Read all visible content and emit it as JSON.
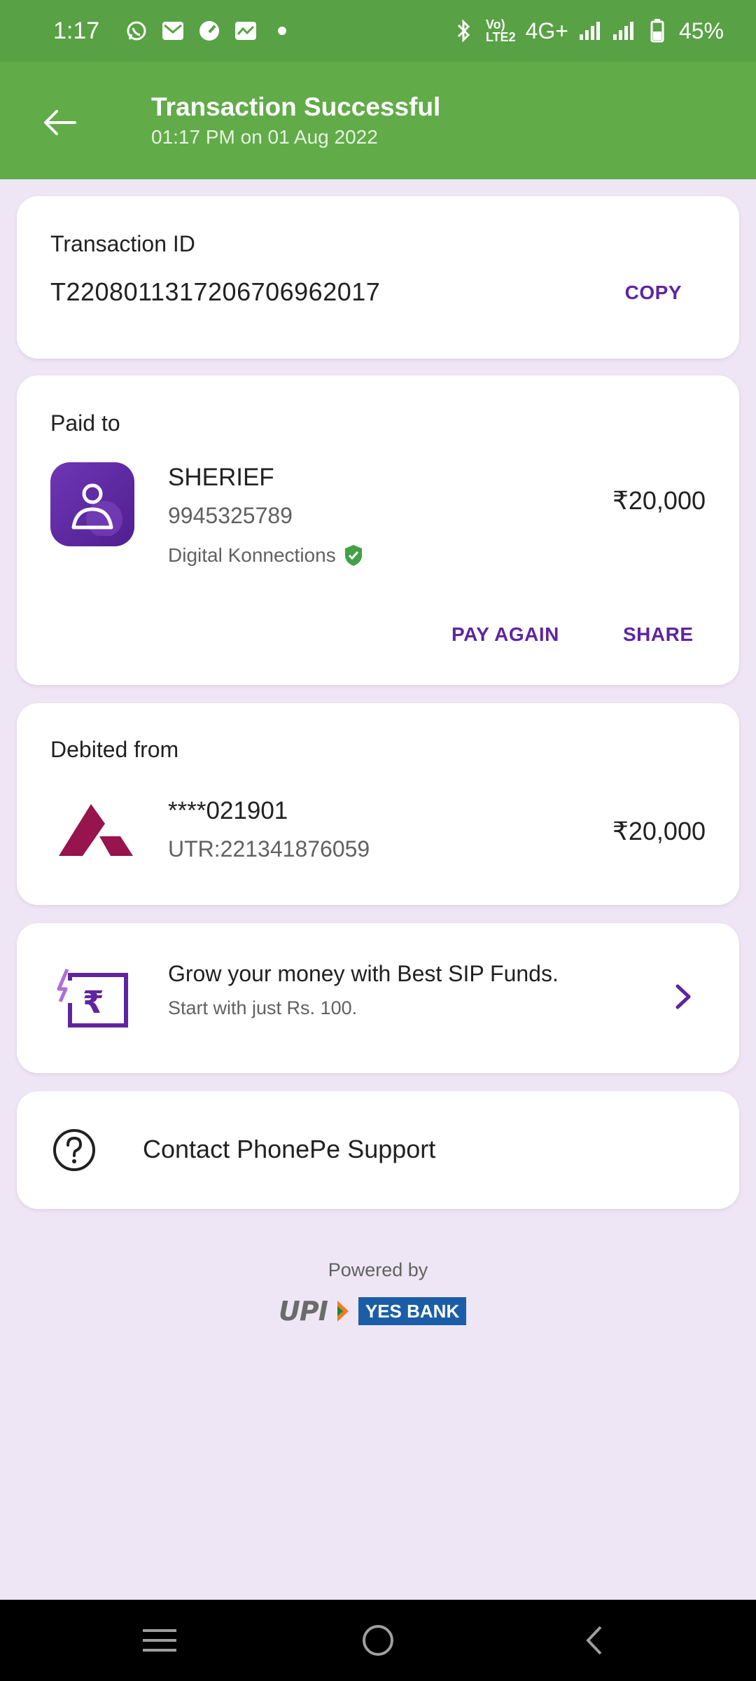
{
  "status_bar": {
    "time": "1:17",
    "network": "4G+",
    "volte": "Vo))\nLTE2",
    "battery": "45%",
    "icons": [
      "whatsapp-icon",
      "gmail-icon",
      "speedometer-icon",
      "messages-icon",
      "dot-icon",
      "bluetooth-icon",
      "signal-icon",
      "battery-icon"
    ]
  },
  "header": {
    "title": "Transaction Successful",
    "subtitle": "01:17 PM on 01 Aug 2022",
    "bg_color": "#61ab48"
  },
  "transaction": {
    "label": "Transaction ID",
    "id": "T2208011317206706962017",
    "copy_label": "COPY"
  },
  "paid_to": {
    "label": "Paid to",
    "name": "SHERIEF",
    "phone": "9945325789",
    "org": "Digital Konnections",
    "amount": "₹20,000",
    "pay_again_label": "PAY AGAIN",
    "share_label": "SHARE"
  },
  "debited_from": {
    "label": "Debited from",
    "account": "****021901",
    "utr": "UTR:221341876059",
    "amount": "₹20,000"
  },
  "promo": {
    "title": "Grow your money with Best SIP Funds.",
    "subtitle": "Start with just Rs. 100."
  },
  "support": {
    "label": "Contact PhonePe Support"
  },
  "footer": {
    "powered_by": "Powered by",
    "upi": "UPI",
    "bank": "YES BANK"
  },
  "colors": {
    "accent": "#5f259f",
    "success": "#61ab48",
    "background": "#efe6f5"
  }
}
